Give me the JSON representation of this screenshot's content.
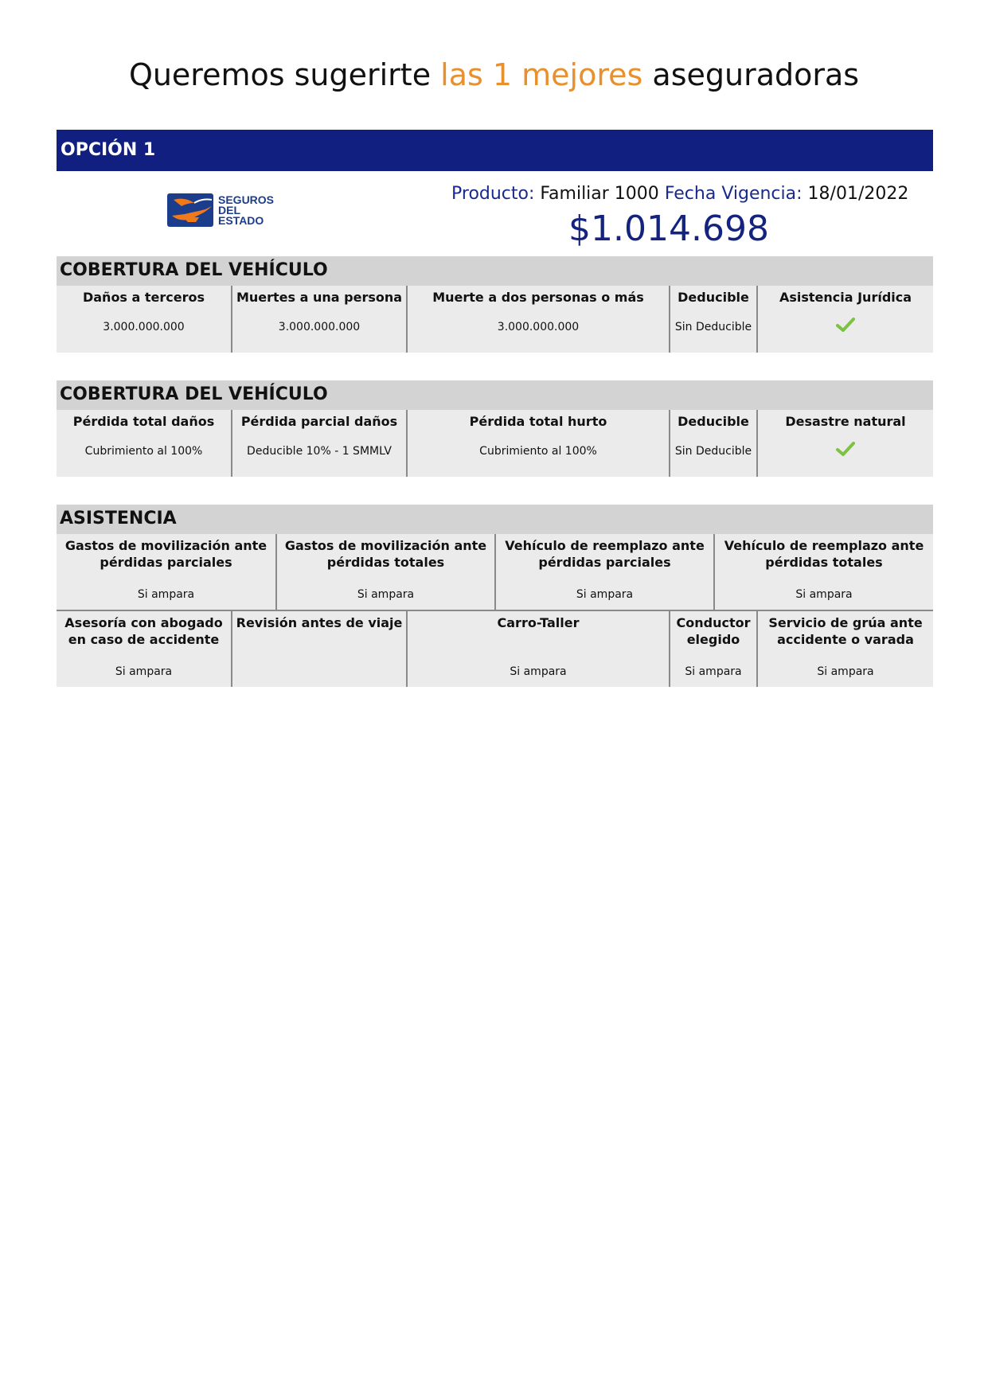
{
  "title": {
    "part1": "Queremos sugerirte ",
    "highlight": "las 1 mejores",
    "part2": " aseguradoras"
  },
  "option": {
    "label": "OPCIÓN 1"
  },
  "insurer": {
    "logo_text": [
      "SEGUROS",
      "DEL",
      "ESTADO"
    ]
  },
  "product": {
    "product_label": "Producto:",
    "product_value": "Familiar 1000",
    "date_label": "Fecha Vigencia:",
    "date_value": "18/01/2022",
    "price": "$1.014.698"
  },
  "colors": {
    "brand_blue": "#112080",
    "accent_orange": "#e8902d",
    "check_green": "#7dc242"
  },
  "coverage1": {
    "title": "COBERTURA DEL VEHÍCULO",
    "headers": [
      "Daños a terceros",
      "Muertes a una persona",
      "Muerte a dos personas o más",
      "Deducible",
      "Asistencia Jurídica"
    ],
    "values": [
      "3.000.000.000",
      "3.000.000.000",
      "3.000.000.000",
      "Sin Deducible",
      "check-icon"
    ]
  },
  "coverage2": {
    "title": "COBERTURA DEL VEHÍCULO",
    "headers": [
      "Pérdida total daños",
      "Pérdida parcial daños",
      "Pérdida total hurto",
      "Deducible",
      "Desastre natural"
    ],
    "values": [
      "Cubrimiento al 100%",
      "Deducible 10% - 1 SMMLV",
      "Cubrimiento al 100%",
      "Sin Deducible",
      "check-icon"
    ]
  },
  "assistance": {
    "title": "ASISTENCIA",
    "row1": {
      "headers": [
        "Gastos de movilización ante pérdidas parciales",
        "Gastos de movilización ante pérdidas totales",
        "Vehículo de reemplazo ante pérdidas parciales",
        "Vehículo de reemplazo ante pérdidas totales"
      ],
      "values": [
        "Si ampara",
        "Si ampara",
        "Si ampara",
        "Si ampara"
      ]
    },
    "row2": {
      "headers": [
        "Asesoría con abogado en caso de accidente",
        "Revisión antes de viaje",
        "Carro-Taller",
        "Conductor elegido",
        "Servicio de grúa ante accidente o varada"
      ],
      "values": [
        "Si ampara",
        "",
        "Si ampara",
        "Si ampara",
        "Si ampara"
      ]
    }
  }
}
